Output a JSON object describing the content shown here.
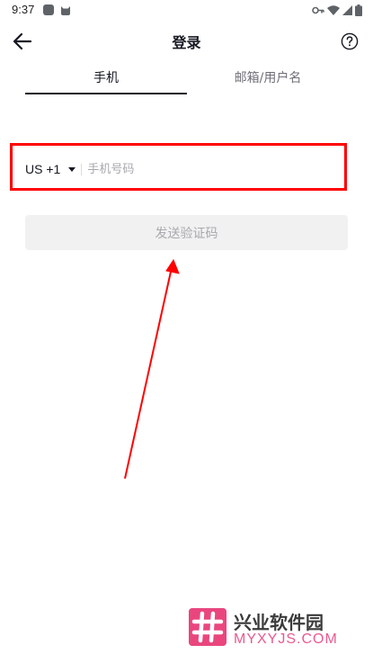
{
  "status_bar": {
    "time": "9:37"
  },
  "header": {
    "title": "登录",
    "back_icon": "arrow-left-icon",
    "help_icon": "question-circle-icon"
  },
  "tabs": [
    {
      "label": "手机",
      "selected": true
    },
    {
      "label": "邮箱/用户名",
      "selected": false
    }
  ],
  "phone": {
    "country_code": "US +1",
    "placeholder": "手机号码",
    "value": ""
  },
  "send_code_label": "发送验证码",
  "watermark": {
    "name": "兴业软件园",
    "url": "MYXYJS.COM"
  },
  "colors": {
    "annotation": "#ff0000",
    "button_bg": "#f1f1f2",
    "watermark_pink": "#e9467e"
  }
}
